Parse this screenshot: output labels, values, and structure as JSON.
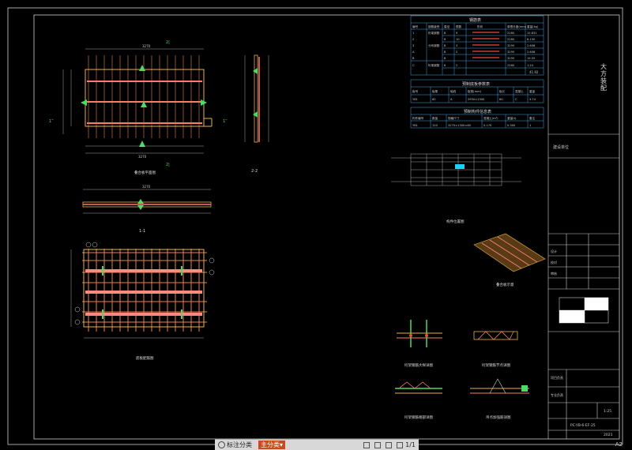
{
  "table1": {
    "title": "钢筋表",
    "headers": [
      "编号",
      "钢筋级别",
      "直径",
      "根数",
      "形状",
      "单根长度(mm)",
      "重量(kg)"
    ],
    "rows": [
      [
        "1",
        "桁架钢筋",
        "8",
        "9",
        "",
        "2280",
        "15.631"
      ],
      [
        "2",
        "",
        "6",
        "10",
        "",
        "2280",
        "6.150"
      ],
      [
        "3",
        "分布钢筋",
        "8",
        "3",
        "",
        "3295",
        "2.608"
      ],
      [
        "A",
        "",
        "8",
        "2",
        "",
        "3295",
        "2.608"
      ],
      [
        "B",
        "",
        "8",
        "",
        "",
        "3295",
        "19.55"
      ],
      [
        "C",
        "桁架钢筋",
        "8",
        "2",
        "",
        "2280",
        "1.24"
      ]
    ],
    "total": "41.92"
  },
  "table2": {
    "title": "预制底板参数表",
    "headers": [
      "板号",
      "板厚",
      "轴线",
      "板宽(mm)",
      "板长",
      "混凝土",
      "重量"
    ],
    "row": [
      "YB1",
      "60",
      "A",
      "2950×1300",
      "60",
      "C",
      "3.74"
    ]
  },
  "table3": {
    "title": "预制构件信息表",
    "headers": [
      "构件编号",
      "数量",
      "规格尺寸",
      "混凝土(m³)",
      "重量(t)",
      "备注"
    ],
    "row": [
      "YB1",
      "120",
      "3270×1300×60",
      "0.170",
      "0.300",
      "1"
    ]
  },
  "titleblock": {
    "company": "大方装配",
    "project": "建设单位",
    "fields": [
      "设计",
      "校对",
      "审核",
      "项目负责",
      "专业负责"
    ],
    "drawing_no": "PC-YB-6-EF-25",
    "sheet": "1:25",
    "date": "2021"
  },
  "labels": {
    "plan": "叠合板平面图",
    "section11": "1-1",
    "section22": "2-2",
    "rebar": "底板配筋图",
    "keyplan": "构件位置图",
    "iso": "叠合板示意",
    "d1": "桁架钢筋大样详图",
    "d2": "桁架钢筋节点详图",
    "d3": "桁架钢筋端部详图",
    "d4": "吊点加强筋详图"
  },
  "toolbar": {
    "mode": "标注分类",
    "layer": "主分类",
    "page": "1/1"
  },
  "corner": "A2"
}
